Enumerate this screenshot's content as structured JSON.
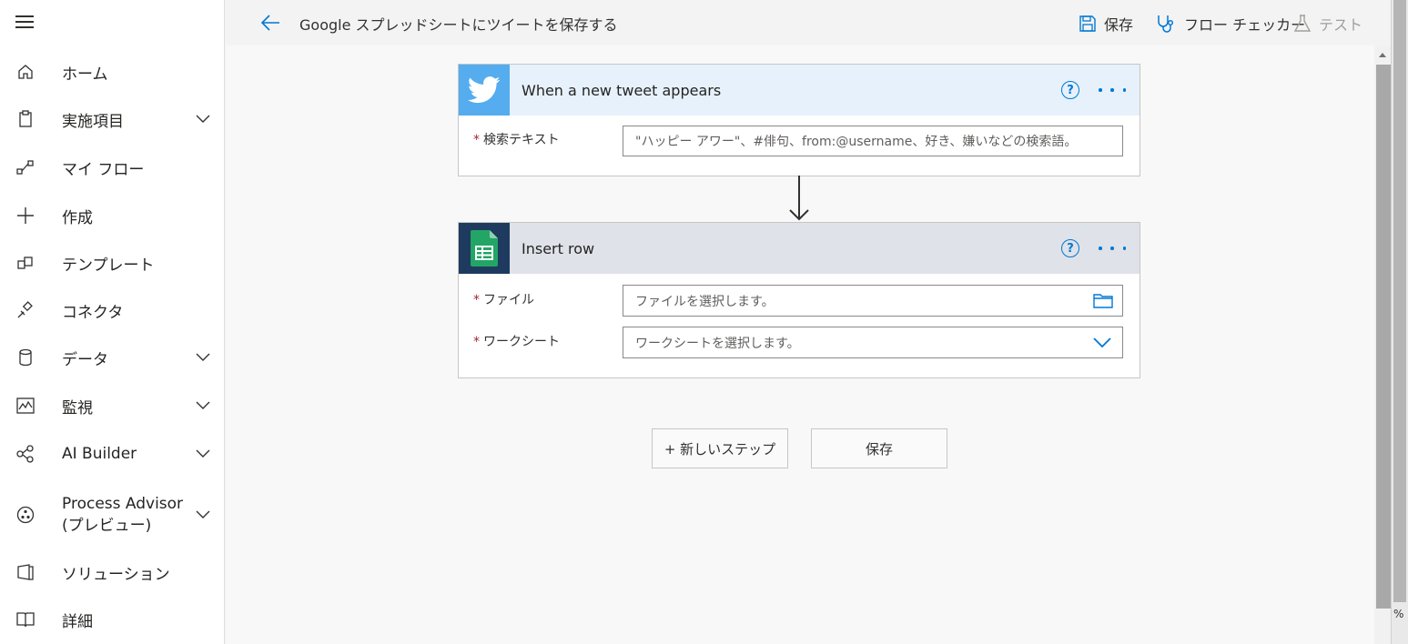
{
  "header": {
    "title": "Google スプレッドシートにツイートを保存する",
    "save_label": "保存",
    "checker_label": "フロー チェッカー",
    "test_label": "テスト"
  },
  "sidebar": {
    "items": [
      {
        "label": "ホーム",
        "icon": "home-icon",
        "chevron": false
      },
      {
        "label": "実施項目",
        "icon": "clipboard-icon",
        "chevron": true
      },
      {
        "label": "マイ フロー",
        "icon": "flow-icon",
        "chevron": false
      },
      {
        "label": "作成",
        "icon": "plus-icon",
        "chevron": false
      },
      {
        "label": "テンプレート",
        "icon": "template-icon",
        "chevron": false
      },
      {
        "label": "コネクタ",
        "icon": "connector-icon",
        "chevron": false
      },
      {
        "label": "データ",
        "icon": "database-icon",
        "chevron": true
      },
      {
        "label": "監視",
        "icon": "monitor-icon",
        "chevron": true
      },
      {
        "label": "AI Builder",
        "icon": "ai-builder-icon",
        "chevron": true
      },
      {
        "label": "Process Advisor",
        "label2": "(プレビュー)",
        "icon": "process-advisor-icon",
        "chevron": true
      },
      {
        "label": "ソリューション",
        "icon": "solutions-icon",
        "chevron": false
      },
      {
        "label": "詳細",
        "icon": "book-icon",
        "chevron": false
      }
    ]
  },
  "trigger": {
    "title": "When a new tweet appears",
    "accent": "#55acee",
    "help": "?",
    "fields": [
      {
        "label": "検索テキスト",
        "required": "*",
        "placeholder": "\"ハッピー アワー\"、#俳句、from:@username、好き、嫌いなどの検索語。"
      }
    ]
  },
  "action": {
    "title": "Insert row",
    "accent": "#1e3a5f",
    "help": "?",
    "fields": [
      {
        "label": "ファイル",
        "required": "*",
        "placeholder": "ファイルを選択します。"
      },
      {
        "label": "ワークシート",
        "required": "*",
        "placeholder": "ワークシートを選択します。"
      }
    ]
  },
  "buttons": {
    "new_step": "+ 新しいステップ",
    "save": "保存"
  },
  "edge": {
    "percent": "%"
  }
}
